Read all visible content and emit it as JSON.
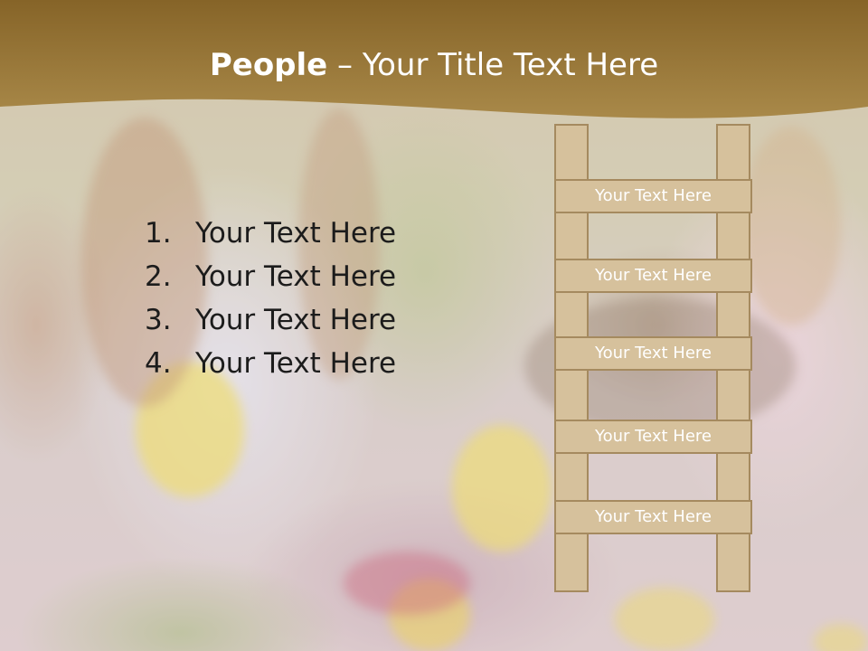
{
  "slide": {
    "title_bold": "People",
    "title_sep": " – ",
    "title_rest": "Your Title Text Here"
  },
  "list": [
    {
      "number": "1.",
      "text": "Your Text Here"
    },
    {
      "number": "2.",
      "text": "Your Text Here"
    },
    {
      "number": "3.",
      "text": "Your Text Here"
    },
    {
      "number": "4.",
      "text": "Your Text Here"
    }
  ],
  "ladder": {
    "rungs": [
      {
        "label": "Your Text Here"
      },
      {
        "label": "Your Text Here"
      },
      {
        "label": "Your Text Here"
      },
      {
        "label": "Your Text Here"
      },
      {
        "label": "Your Text Here"
      }
    ]
  },
  "colors": {
    "header_gold": "#9c7a3a",
    "ladder_fill": "#d6c19c",
    "ladder_stroke": "#a58a5f",
    "title_text": "#ffffff",
    "list_text": "#1c1c1c"
  }
}
